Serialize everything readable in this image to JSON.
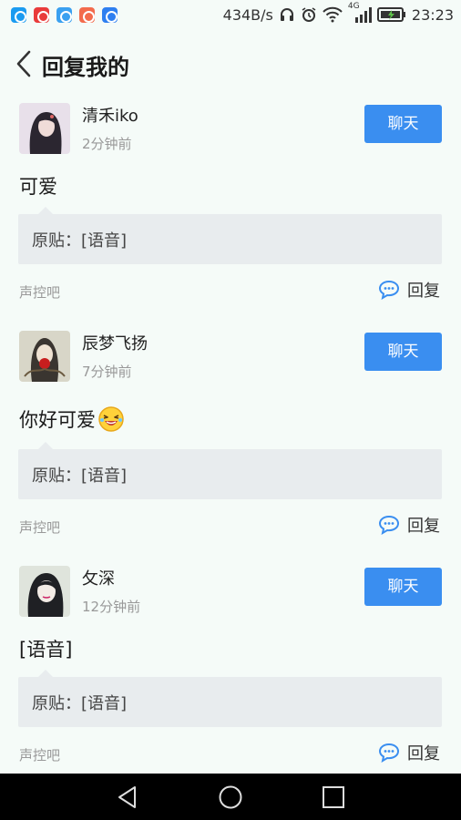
{
  "status_bar": {
    "net_speed": "434B/s",
    "network_type": "4G",
    "time": "23:23",
    "app_icon_colors": [
      "#1b9bf0",
      "#e93b3b",
      "#3aa0f0",
      "#f36b4c",
      "#2f7ff0"
    ]
  },
  "header": {
    "title": "回复我的"
  },
  "colors": {
    "accent": "#3a8ef0",
    "page_bg": "#f5fbf8",
    "box_bg": "#e8ecee"
  },
  "replies": [
    {
      "username": "清禾iko",
      "time": "2分钟前",
      "chat_label": "聊天",
      "content": "可爱",
      "emoji": "",
      "original": "原贴：[语音]",
      "forum": "声控吧",
      "reply_label": "回复"
    },
    {
      "username": "辰梦飞扬",
      "time": "7分钟前",
      "chat_label": "聊天",
      "content": "你好可爱",
      "emoji": "laughing-emoji",
      "original": "原贴：[语音]",
      "forum": "声控吧",
      "reply_label": "回复"
    },
    {
      "username": "攵深",
      "time": "12分钟前",
      "chat_label": "聊天",
      "content": "[语音]",
      "emoji": "",
      "original": "原贴：[语音]",
      "forum": "声控吧",
      "reply_label": "回复"
    }
  ]
}
